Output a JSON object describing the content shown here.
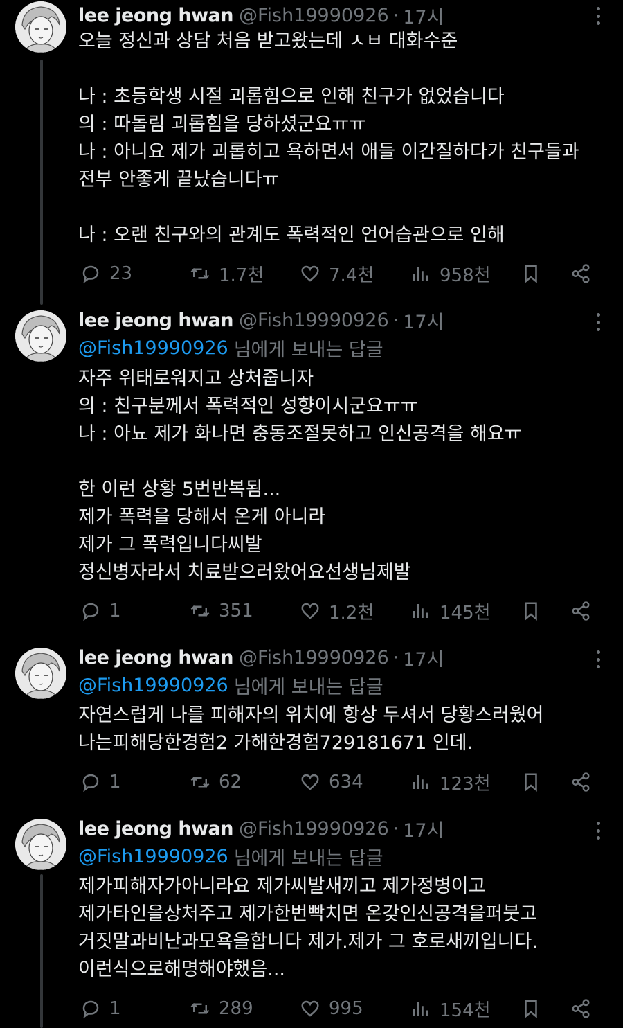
{
  "tweets": [
    {
      "author": {
        "name": "lee jeong hwan",
        "handle": "@Fish19990926",
        "dot": "·",
        "time": "17시"
      },
      "reply_to": null,
      "lines": [
        "오늘 정신과 상담 처음 받고왔는데 ㅅㅂ 대화수준",
        "",
        "나 : 초등학생 시절 괴롭힘으로 인해 친구가 없었습니다",
        "의 : 따돌림 괴롭힘을 당하셨군요ㅠㅠ",
        "나 : 아니요 제가 괴롭히고 욕하면서 애들 이간질하다가 친구들과",
        "전부 안좋게 끝났습니다ㅠ",
        "",
        "나 : 오랜 친구와의 관계도 폭력적인 언어습관으로 인해"
      ],
      "stats": {
        "replies": "23",
        "retweets": "1.7천",
        "likes": "7.4천",
        "views": "958천"
      }
    },
    {
      "author": {
        "name": "lee jeong hwan",
        "handle": "@Fish19990926",
        "dot": "·",
        "time": "17시"
      },
      "reply_to": {
        "handle": "@Fish19990926",
        "suffix": "님에게 보내는 답글"
      },
      "lines": [
        "자주 위태로워지고 상처줍니자",
        "의 : 친구분께서 폭력적인 성향이시군요ㅠㅠ",
        "나 : 아뇨 제가 화나면 충동조절못하고 인신공격을 해요ㅠ",
        "",
        "한 이런 상황 5번반복됨...",
        "제가 폭력을 당해서 온게 아니라",
        "제가 그 폭력입니다씨발",
        "정신병자라서 치료받으러왔어요선생님제발"
      ],
      "stats": {
        "replies": "1",
        "retweets": "351",
        "likes": "1.2천",
        "views": "145천"
      }
    },
    {
      "author": {
        "name": "lee jeong hwan",
        "handle": "@Fish19990926",
        "dot": "·",
        "time": "17시"
      },
      "reply_to": {
        "handle": "@Fish19990926",
        "suffix": "님에게 보내는 답글"
      },
      "lines": [
        "자연스럽게 나를 피해자의 위치에 항상 두셔서 당황스러웠어",
        "나는피해당한경험2 가해한경험729181671 인데."
      ],
      "stats": {
        "replies": "1",
        "retweets": "62",
        "likes": "634",
        "views": "123천"
      }
    },
    {
      "author": {
        "name": "lee jeong hwan",
        "handle": "@Fish19990926",
        "dot": "·",
        "time": "17시"
      },
      "reply_to": {
        "handle": "@Fish19990926",
        "suffix": "님에게 보내는 답글"
      },
      "lines": [
        "제가피해자가아니라요 제가씨발새끼고 제가정병이고",
        "제가타인을상처주고 제가한번빡치면 온갖인신공격을퍼붓고",
        "거짓말과비난과모욕을합니다 제가.제가 그 호로새끼입니다.",
        "이런식으로해명해야했음..."
      ],
      "stats": {
        "replies": "1",
        "retweets": "289",
        "likes": "995",
        "views": "154천"
      }
    }
  ],
  "icons": {
    "reply": "reply-icon",
    "retweet": "retweet-icon",
    "like": "heart-icon",
    "views": "views-icon",
    "bookmark": "bookmark-icon",
    "share": "share-icon",
    "more": "more-icon"
  },
  "colors": {
    "background": "#000000",
    "text": "#e7e9ea",
    "muted": "#71767b",
    "link": "#1d9bf0"
  }
}
